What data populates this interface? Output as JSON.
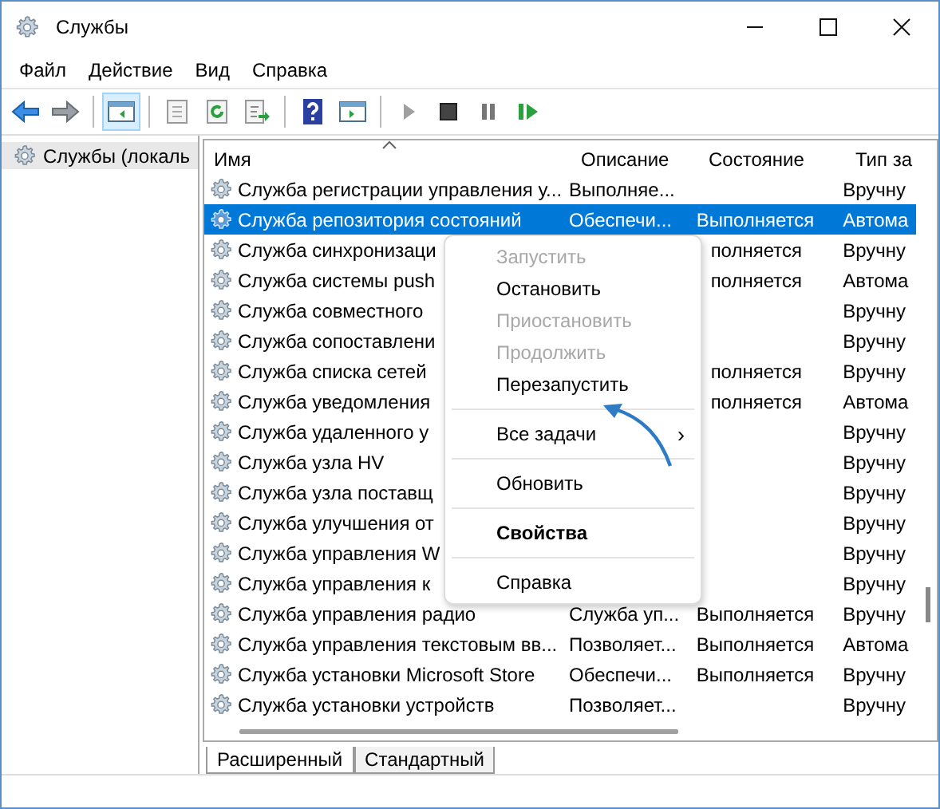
{
  "window": {
    "title": "Службы"
  },
  "menu": [
    "Файл",
    "Действие",
    "Вид",
    "Справка"
  ],
  "toolbar": [
    {
      "kind": "back"
    },
    {
      "kind": "forward"
    },
    {
      "kind": "sep"
    },
    {
      "kind": "tree",
      "selected": true
    },
    {
      "kind": "sep"
    },
    {
      "kind": "props"
    },
    {
      "kind": "refresh"
    },
    {
      "kind": "export"
    },
    {
      "kind": "sep"
    },
    {
      "kind": "help"
    },
    {
      "kind": "panel"
    },
    {
      "kind": "sep"
    },
    {
      "kind": "play"
    },
    {
      "kind": "stop"
    },
    {
      "kind": "pause"
    },
    {
      "kind": "resume"
    }
  ],
  "tree": {
    "label": "Службы (локаль",
    "selected": true
  },
  "table": {
    "columns": [
      "Имя",
      "Описание",
      "Состояние",
      "Тип за"
    ],
    "rows": [
      {
        "name": "Служба регистрации управления у...",
        "description": "Выполняе...",
        "state": "",
        "startup": "Вручну",
        "selected": false
      },
      {
        "name": "Служба репозитория состояний",
        "description": "Обеспечи...",
        "state": "Выполняется",
        "startup": "Автома",
        "selected": true
      },
      {
        "name": "Служба синхронизаци",
        "description": "",
        "state": "полняется",
        "startup": "Вручну",
        "selected": false,
        "partly_hidden": true
      },
      {
        "name": "Служба системы push",
        "description": "",
        "state": "полняется",
        "startup": "Автома",
        "selected": false,
        "partly_hidden": true
      },
      {
        "name": "Служба совместного",
        "description": "",
        "state": "",
        "startup": "Вручну",
        "selected": false
      },
      {
        "name": "Служба сопоставлени",
        "description": "",
        "state": "",
        "startup": "Вручну",
        "selected": false
      },
      {
        "name": "Служба списка сетей",
        "description": "",
        "state": "полняется",
        "startup": "Вручну",
        "selected": false,
        "partly_hidden": true
      },
      {
        "name": "Служба уведомления",
        "description": "",
        "state": "полняется",
        "startup": "Автома",
        "selected": false,
        "partly_hidden": true
      },
      {
        "name": "Служба удаленного у",
        "description": "",
        "state": "",
        "startup": "Вручну",
        "selected": false
      },
      {
        "name": "Служба узла HV",
        "description": "",
        "state": "",
        "startup": "Вручну",
        "selected": false
      },
      {
        "name": "Служба узла поставщ",
        "description": "",
        "state": "",
        "startup": "Вручну",
        "selected": false
      },
      {
        "name": "Служба улучшения от",
        "description": "",
        "state": "",
        "startup": "Вручну",
        "selected": false
      },
      {
        "name": "Служба управления W",
        "description": "",
        "state": "",
        "startup": "Вручну",
        "selected": false
      },
      {
        "name": "Служба управления к",
        "description": "",
        "state": "",
        "startup": "Вручну",
        "selected": false
      },
      {
        "name": "Служба управления радио",
        "description": "Служба уп...",
        "state": "Выполняется",
        "startup": "Вручну",
        "selected": false
      },
      {
        "name": "Служба управления текстовым вв...",
        "description": "Позволяет...",
        "state": "Выполняется",
        "startup": "Автома",
        "selected": false
      },
      {
        "name": "Служба установки Microsoft Store",
        "description": "Обеспечи...",
        "state": "Выполняется",
        "startup": "Вручну",
        "selected": false
      },
      {
        "name": "Служба установки устройств",
        "description": "Позволяет...",
        "state": "",
        "startup": "Вручну",
        "selected": false
      }
    ]
  },
  "context_menu": [
    {
      "kind": "item",
      "label": "Запустить",
      "disabled": true
    },
    {
      "kind": "item",
      "label": "Остановить",
      "disabled": false
    },
    {
      "kind": "item",
      "label": "Приостановить",
      "disabled": true
    },
    {
      "kind": "item",
      "label": "Продолжить",
      "disabled": true
    },
    {
      "kind": "item",
      "label": "Перезапустить",
      "disabled": false
    },
    {
      "kind": "separator"
    },
    {
      "kind": "submenu",
      "label": "Все задачи",
      "arrow": "›",
      "disabled": false
    },
    {
      "kind": "separator"
    },
    {
      "kind": "item",
      "label": "Обновить",
      "disabled": false
    },
    {
      "kind": "separator"
    },
    {
      "kind": "default",
      "label": "Свойства",
      "disabled": false
    },
    {
      "kind": "separator"
    },
    {
      "kind": "item",
      "label": "Справка",
      "disabled": false
    }
  ],
  "tabs": [
    {
      "label": "Расширенный",
      "selected": true
    },
    {
      "label": "Стандартный",
      "selected": false
    }
  ]
}
